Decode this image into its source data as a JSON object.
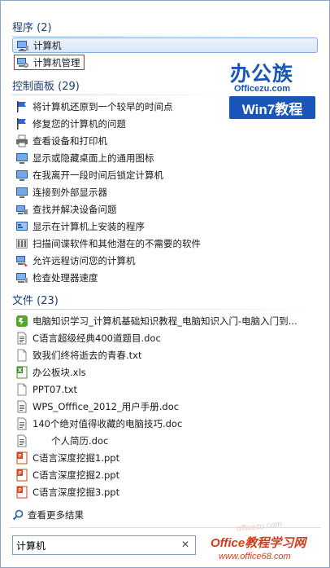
{
  "sections": {
    "programs": {
      "title": "程序 (2)"
    },
    "control_panel": {
      "title": "控制面板 (29)"
    },
    "files": {
      "title": "文件 (23)"
    }
  },
  "programs": [
    {
      "label": "计算机",
      "icon": "computer-icon"
    },
    {
      "label": "计算机管理",
      "icon": "computer-management-icon"
    }
  ],
  "control_panel_items": [
    {
      "label": "将计算机还原到一个较早的时间点",
      "icon": "flag-icon"
    },
    {
      "label": "修复您的计算机的问题",
      "icon": "flag-icon"
    },
    {
      "label": "查看设备和打印机",
      "icon": "printer-icon"
    },
    {
      "label": "显示或隐藏桌面上的通用图标",
      "icon": "display-icon"
    },
    {
      "label": "在我离开一段时间后锁定计算机",
      "icon": "display-icon"
    },
    {
      "label": "连接到外部显示器",
      "icon": "display-icon"
    },
    {
      "label": "查找并解决设备问题",
      "icon": "device-icon"
    },
    {
      "label": "显示在计算机上安装的程序",
      "icon": "programs-icon"
    },
    {
      "label": "扫描间谍软件和其他潜在的不需要的软件",
      "icon": "defender-icon"
    },
    {
      "label": "允许远程访问您的计算机",
      "icon": "remote-icon"
    },
    {
      "label": "检查处理器速度",
      "icon": "computer-icon"
    }
  ],
  "files": [
    {
      "label": "电脑知识学习_计算机基础知识教程_电脑知识入门-电脑入门到...",
      "icon": "green-app-icon"
    },
    {
      "label": "C语言超级经典400道题目.doc",
      "icon": "doc-icon"
    },
    {
      "label": "致我们终将逝去的青春.txt",
      "icon": "txt-icon"
    },
    {
      "label": "办公板块.xls",
      "icon": "xls-icon"
    },
    {
      "label": "PPT07.txt",
      "icon": "txt-icon"
    },
    {
      "label": "WPS_Offfice_2012_用户手册.doc",
      "icon": "doc-icon"
    },
    {
      "label": "140个绝对值得收藏的电脑技巧.doc",
      "icon": "doc-icon"
    },
    {
      "label": "　　个人简历.doc",
      "icon": "doc-icon"
    },
    {
      "label": "C语言深度挖掘1.ppt",
      "icon": "ppt-icon"
    },
    {
      "label": "C语言深度挖掘2.ppt",
      "icon": "ppt-icon"
    },
    {
      "label": "C语言深度挖掘3.ppt",
      "icon": "ppt-icon"
    }
  ],
  "more_results": "查看更多结果",
  "search": {
    "value": "计算机"
  },
  "watermarks": {
    "top_cn": "办公族",
    "top_url": "Officezu.com",
    "top_tagline": "Win7教程",
    "bottom_name": "Office教程学习网",
    "bottom_url": "www.office68.com",
    "bottom_faint": "officezu.com"
  },
  "colors": {
    "section_header": "#1e3d72",
    "selection": "#d6e5f7",
    "highlight_box": "#d62a2a",
    "watermark_blue": "#1a56b8",
    "watermark_red": "#d43a1d"
  }
}
